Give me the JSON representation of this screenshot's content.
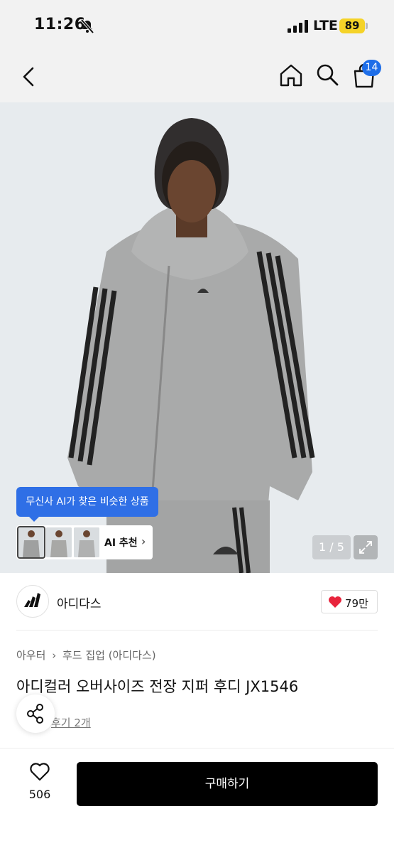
{
  "status": {
    "time": "11:26",
    "network": "LTE",
    "battery": "89"
  },
  "nav": {
    "cart_count": "14"
  },
  "ai": {
    "bubble_text": "무신사 AI가 찾은 비슷한 상품",
    "label": "AI 추천"
  },
  "gallery": {
    "counter": "1 / 5"
  },
  "brand": {
    "name": "아디다스",
    "likes": "79만"
  },
  "breadcrumb": {
    "category": "아우터",
    "subcategory": "후드 집업 (아디다스)"
  },
  "product": {
    "title": "아디컬러 오버사이즈 전장 지퍼 후디 JX1546",
    "reviews": "후기 2개"
  },
  "bottom": {
    "wish_count": "506",
    "buy_label": "구매하기"
  },
  "colors": {
    "accent": "#2f6fe6",
    "battery": "#f5d328",
    "heart": "#e8243c"
  }
}
